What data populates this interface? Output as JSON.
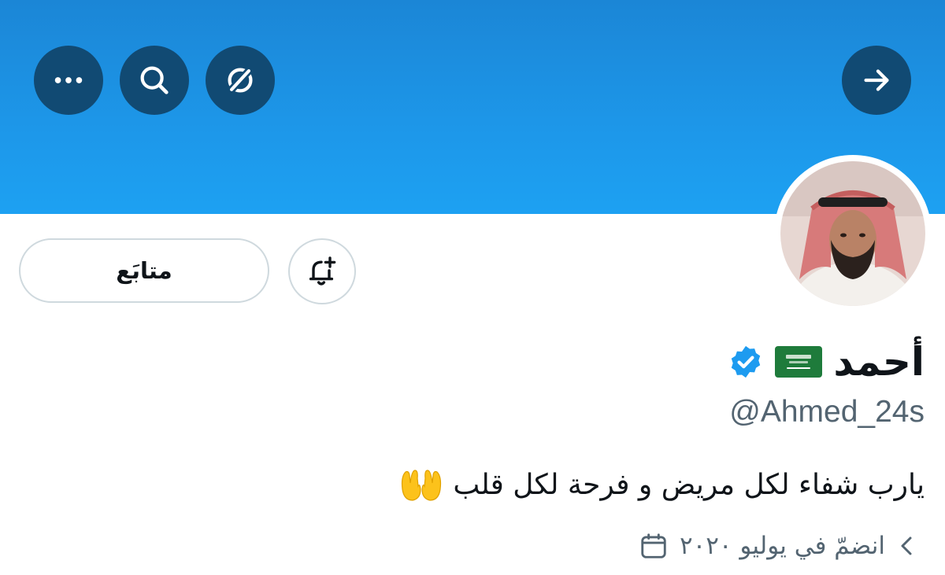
{
  "header": {
    "buttons": {
      "more_icon": "more-icon",
      "search_icon": "search-icon",
      "explore_icon": "explore-icon",
      "forward_icon": "arrow-right-icon"
    },
    "banner_color": "#1d9bf0"
  },
  "profile": {
    "display_name": "أحمد",
    "flag": "saudi-flag",
    "verified": true,
    "handle": "@Ahmed_24s",
    "bio": "يارب شفاء لكل مريض و فرحة لكل قلب",
    "bio_emoji": "palms-up-together",
    "joined": "انضمّ في يوليو ٢٠٢٠"
  },
  "actions": {
    "follow_label": "متابَع",
    "notify_icon": "bell-plus-icon"
  },
  "colors": {
    "accent": "#1d9bf0",
    "verified": "#1d9bf0",
    "secondary_text": "#536471",
    "dark_button": "#114a73"
  }
}
